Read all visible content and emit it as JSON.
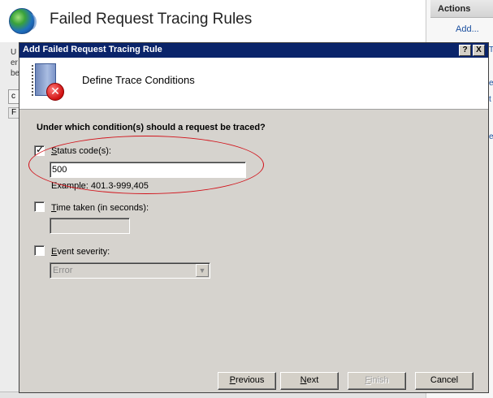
{
  "background": {
    "page_title": "Failed Request Tracing Rules",
    "left_fragments": [
      "U",
      "er",
      "be"
    ],
    "tab_fragments": [
      "c",
      "F"
    ],
    "actions": {
      "header": "Actions",
      "add_label": "Add..."
    },
    "right_fragments": [
      "T",
      "e",
      "t",
      "e"
    ]
  },
  "dialog": {
    "title": "Add Failed Request Tracing Rule",
    "help_button": "?",
    "close_button": "X",
    "banner_title": "Define Trace Conditions",
    "question": "Under which condition(s) should a request be traced?",
    "status": {
      "label_prefix": "",
      "label_accel": "S",
      "label_rest": "tatus code(s):",
      "checked": true,
      "value": "500",
      "example": "Example: 401.3-999,405"
    },
    "time_taken": {
      "label_accel": "T",
      "label_rest": "ime taken (in seconds):",
      "checked": false,
      "value": ""
    },
    "event_severity": {
      "label_accel": "E",
      "label_rest": "vent severity:",
      "checked": false,
      "selected": "Error"
    },
    "buttons": {
      "previous": {
        "accel": "P",
        "rest": "revious"
      },
      "next": {
        "accel": "N",
        "rest": "ext"
      },
      "finish": {
        "accel": "F",
        "rest": "inish"
      },
      "cancel": "Cancel"
    },
    "annotation_color": "#d2121a"
  }
}
